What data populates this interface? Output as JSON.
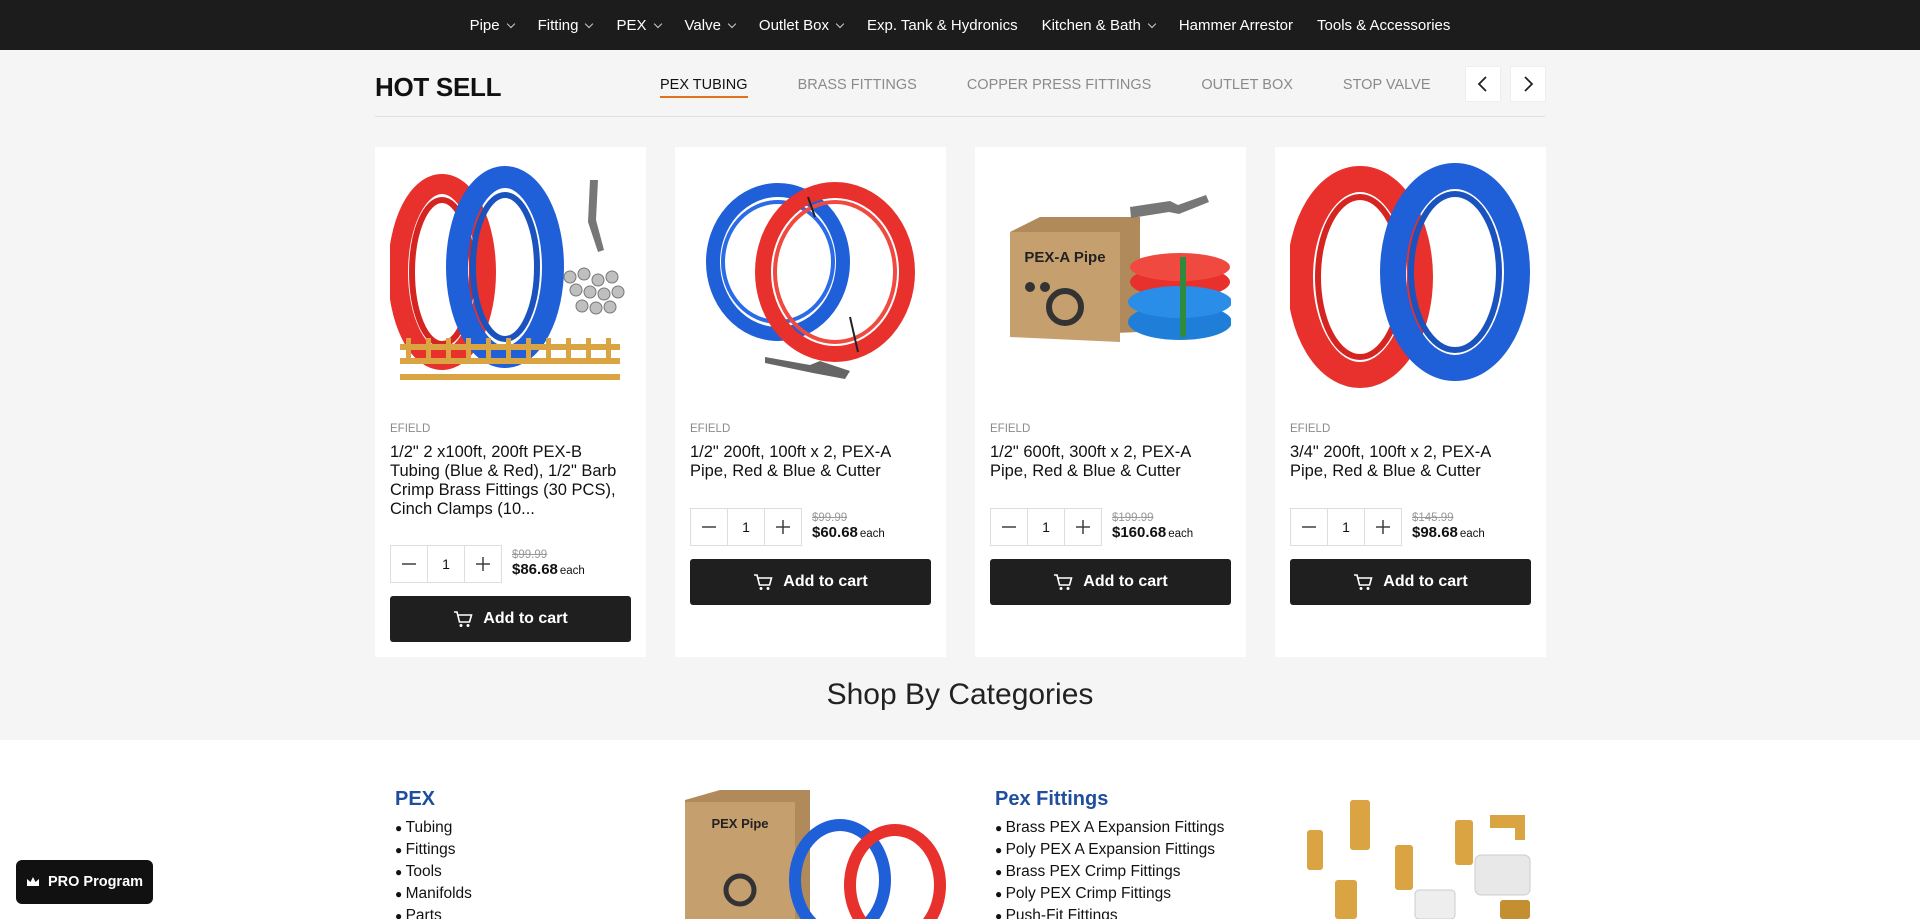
{
  "nav": {
    "items": [
      {
        "label": "Pipe",
        "dropdown": true
      },
      {
        "label": "Fitting",
        "dropdown": true
      },
      {
        "label": "PEX",
        "dropdown": true
      },
      {
        "label": "Valve",
        "dropdown": true
      },
      {
        "label": "Outlet Box",
        "dropdown": true
      },
      {
        "label": "Exp. Tank & Hydronics",
        "dropdown": false
      },
      {
        "label": "Kitchen & Bath",
        "dropdown": true
      },
      {
        "label": "Hammer Arrestor",
        "dropdown": false
      },
      {
        "label": "Tools & Accessories",
        "dropdown": false
      }
    ]
  },
  "hot_sell": {
    "title": "HOT SELL",
    "tabs": [
      "PEX TUBING",
      "BRASS FITTINGS",
      "COPPER PRESS FITTINGS",
      "OUTLET BOX",
      "STOP VALVE"
    ],
    "active_tab": "PEX TUBING"
  },
  "products": [
    {
      "brand": "EFIELD",
      "title": "1/2\" 2 x100ft, 200ft PEX-B Tubing (Blue & Red), 1/2\" Barb Crimp Brass Fittings (30 PCS), Cinch Clamps (10...",
      "qty": "1",
      "old_price": "$99.99",
      "price": "$86.68",
      "each": "each",
      "cta": "Add to cart"
    },
    {
      "brand": "EFIELD",
      "title": "1/2\" 200ft, 100ft x 2, PEX-A Pipe, Red & Blue & Cutter",
      "qty": "1",
      "old_price": "$99.99",
      "price": "$60.68",
      "each": "each",
      "cta": "Add to cart"
    },
    {
      "brand": "EFIELD",
      "title": "1/2\" 600ft, 300ft x 2, PEX-A Pipe, Red & Blue & Cutter",
      "qty": "1",
      "old_price": "$199.99",
      "price": "$160.68",
      "each": "each",
      "cta": "Add to cart"
    },
    {
      "brand": "EFIELD",
      "title": "3/4\" 200ft, 100ft x 2, PEX-A Pipe, Red & Blue & Cutter",
      "qty": "1",
      "old_price": "$145.99",
      "price": "$98.68",
      "each": "each",
      "cta": "Add to cart"
    }
  ],
  "box_label": "PEX-A Pipe",
  "box_label_small": "PEX Pipe",
  "shop_categories": {
    "title": "Shop By Categories",
    "pex": {
      "heading": "PEX",
      "items": [
        "Tubing",
        "Fittings",
        "Tools",
        "Manifolds",
        "Parts"
      ]
    },
    "pex_fittings": {
      "heading": "Pex Fittings",
      "items": [
        "Brass PEX A Expansion Fittings",
        "Poly PEX A Expansion Fittings",
        "Brass PEX Crimp Fittings",
        "Poly PEX Crimp Fittings",
        "Push-Fit Fittings"
      ]
    }
  },
  "pro_program": {
    "label": "PRO Program"
  },
  "colors": {
    "accent": "#e2711d",
    "category_heading": "#1f4e9c",
    "button": "#1f1f1f",
    "pipe_red": "#e8302c",
    "pipe_blue": "#1f5fd8"
  }
}
